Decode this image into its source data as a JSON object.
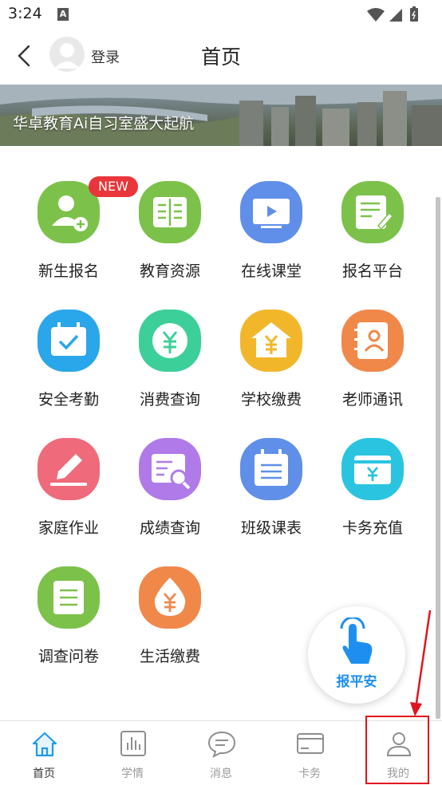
{
  "status_bar": {
    "time": "3:24",
    "notification_icon": "A"
  },
  "header": {
    "login_label": "登录",
    "title": "首页"
  },
  "banner": {
    "text": "华卓教育Ai自习室盛大起航"
  },
  "badge": {
    "new": "NEW"
  },
  "grid": [
    {
      "label": "新生报名",
      "icon": "add-user-icon",
      "color": "#7cc24a"
    },
    {
      "label": "教育资源",
      "icon": "book-icon",
      "color": "#7cc24a"
    },
    {
      "label": "在线课堂",
      "icon": "video-icon",
      "color": "#5f8fe8"
    },
    {
      "label": "报名平台",
      "icon": "edit-form-icon",
      "color": "#7cc24a"
    },
    {
      "label": "安全考勤",
      "icon": "calendar-check-icon",
      "color": "#2aa6ea"
    },
    {
      "label": "消费查询",
      "icon": "yuan-coin-icon",
      "color": "#3ccf9a"
    },
    {
      "label": "学校缴费",
      "icon": "school-yuan-icon",
      "color": "#f2b62a"
    },
    {
      "label": "老师通讯",
      "icon": "contact-book-icon",
      "color": "#f0884a"
    },
    {
      "label": "家庭作业",
      "icon": "pencil-icon",
      "color": "#ef6a7a"
    },
    {
      "label": "成绩查询",
      "icon": "report-search-icon",
      "color": "#b07ae8"
    },
    {
      "label": "班级课表",
      "icon": "schedule-icon",
      "color": "#5f8fe8"
    },
    {
      "label": "卡务充值",
      "icon": "card-yuan-icon",
      "color": "#2ac4e0"
    },
    {
      "label": "调查问卷",
      "icon": "questionnaire-icon",
      "color": "#7cc24a"
    },
    {
      "label": "生活缴费",
      "icon": "water-drop-yuan-icon",
      "color": "#f0884a"
    }
  ],
  "float_button": {
    "label": "报平安",
    "icon": "tap-hand-icon"
  },
  "bottom_nav": [
    {
      "label": "首页",
      "icon": "home-icon",
      "active": true
    },
    {
      "label": "学情",
      "icon": "bar-chart-icon",
      "active": false
    },
    {
      "label": "消息",
      "icon": "chat-bubble-icon",
      "active": false
    },
    {
      "label": "卡务",
      "icon": "card-icon",
      "active": false
    },
    {
      "label": "我的",
      "icon": "user-icon",
      "active": false
    }
  ],
  "colors": {
    "accent": "#1e8ff0",
    "highlight_box": "#e0141e"
  }
}
